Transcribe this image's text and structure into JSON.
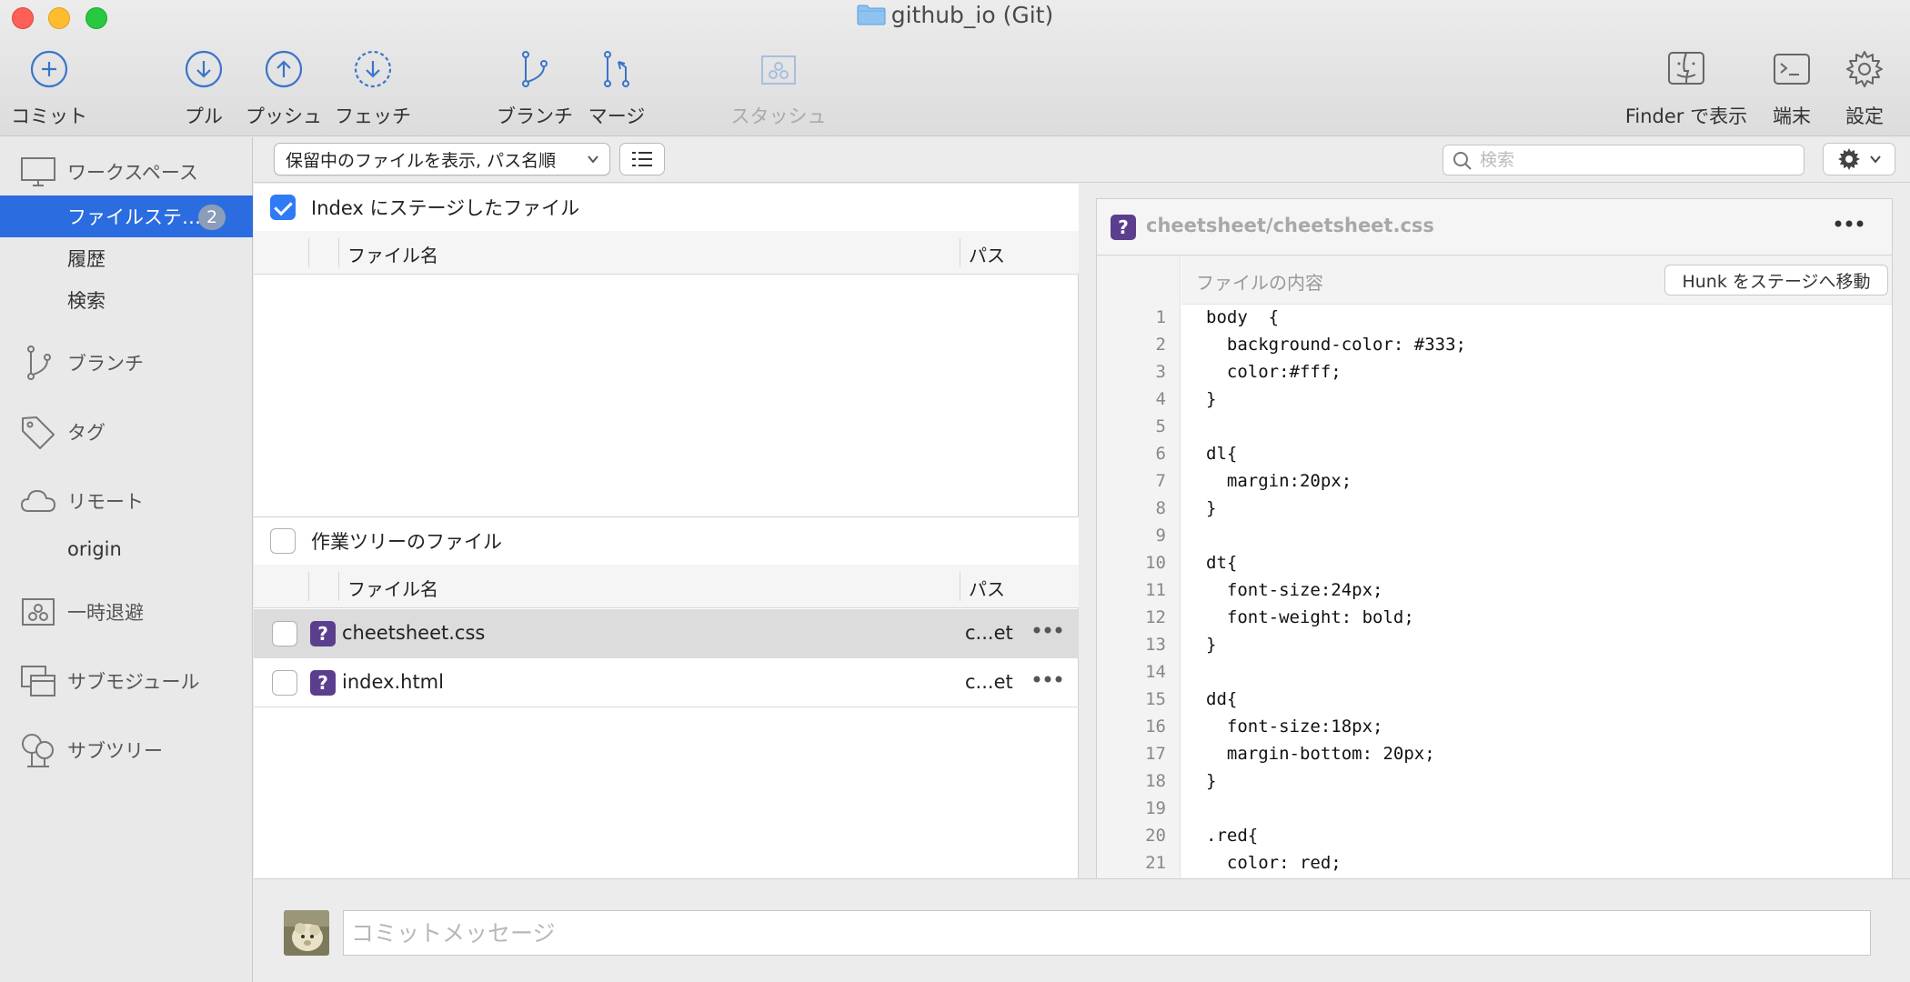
{
  "window": {
    "title": "github_io (Git)"
  },
  "toolbar": {
    "commit": "コミット",
    "pull": "プル",
    "push": "プッシュ",
    "fetch": "フェッチ",
    "branch": "ブランチ",
    "merge": "マージ",
    "stash": "スタッシュ",
    "finder": "Finder で表示",
    "terminal": "端末",
    "settings": "設定"
  },
  "sidebar": {
    "workspace": {
      "label": "ワークスペース",
      "items": [
        {
          "label": "ファイルステ…",
          "badge": "2",
          "selected": true
        },
        {
          "label": "履歴"
        },
        {
          "label": "検索"
        }
      ]
    },
    "branches": "ブランチ",
    "tags": "タグ",
    "remotes": {
      "label": "リモート",
      "items": [
        "origin"
      ]
    },
    "stashes": "一時退避",
    "submodules": "サブモジュール",
    "subtrees": "サブツリー"
  },
  "filter": {
    "dropdown": "保留中のファイルを表示, パス名順",
    "search_placeholder": "検索"
  },
  "staged": {
    "title": "Index にステージしたファイル",
    "checked": true,
    "col_name": "ファイル名",
    "col_path": "パス"
  },
  "unstaged": {
    "title": "作業ツリーのファイル",
    "checked": false,
    "col_name": "ファイル名",
    "col_path": "パス",
    "files": [
      {
        "name": "cheetsheet.css",
        "path": "c...et",
        "status": "?"
      },
      {
        "name": "index.html",
        "path": "c...et",
        "status": "?"
      }
    ]
  },
  "diff": {
    "file": "cheetsheet/cheetsheet.css",
    "status": "?",
    "hunk_title": "ファイルの内容",
    "hunk_button": "Hunk をステージへ移動",
    "lines": [
      {
        "n": "1",
        "t": "body  {"
      },
      {
        "n": "2",
        "t": "  background-color: #333;"
      },
      {
        "n": "3",
        "t": "  color:#fff;"
      },
      {
        "n": "4",
        "t": "}"
      },
      {
        "n": "5",
        "t": ""
      },
      {
        "n": "6",
        "t": "dl{"
      },
      {
        "n": "7",
        "t": "  margin:20px;"
      },
      {
        "n": "8",
        "t": "}"
      },
      {
        "n": "9",
        "t": ""
      },
      {
        "n": "10",
        "t": "dt{"
      },
      {
        "n": "11",
        "t": "  font-size:24px;"
      },
      {
        "n": "12",
        "t": "  font-weight: bold;"
      },
      {
        "n": "13",
        "t": "}"
      },
      {
        "n": "14",
        "t": ""
      },
      {
        "n": "15",
        "t": "dd{"
      },
      {
        "n": "16",
        "t": "  font-size:18px;"
      },
      {
        "n": "17",
        "t": "  margin-bottom: 20px;"
      },
      {
        "n": "18",
        "t": "}"
      },
      {
        "n": "19",
        "t": ""
      },
      {
        "n": "20",
        "t": ".red{"
      },
      {
        "n": "21",
        "t": "  color: red;"
      }
    ]
  },
  "commit": {
    "placeholder": "コミットメッセージ"
  },
  "colors": {
    "accent": "#2b6de0",
    "badge_purple": "#5b3e8e",
    "icon_blue": "#3a74c9",
    "checkbox_blue": "#2f7bf5"
  }
}
